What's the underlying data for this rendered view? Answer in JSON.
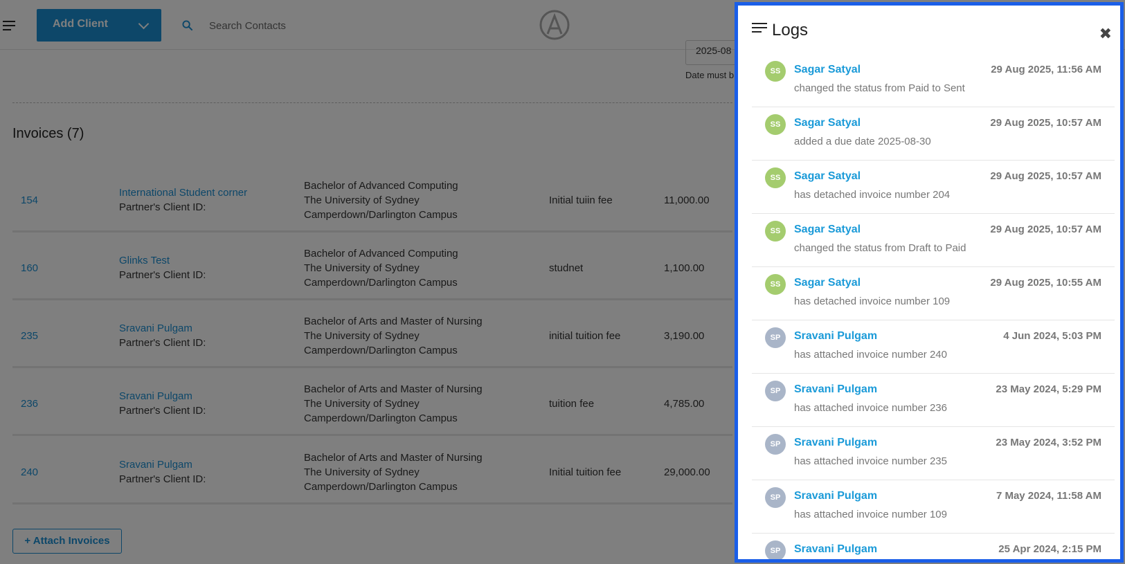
{
  "header": {
    "add_client_label": "Add Client",
    "search_placeholder": "Search Contacts"
  },
  "date_field": {
    "value": "2025-08",
    "hint": "Date must b"
  },
  "invoices": {
    "title": "Invoices (7)",
    "rows": [
      {
        "number": "154",
        "client": "International Student corner",
        "partner": "Partner's Client ID:",
        "course": "Bachelor of Advanced Computing",
        "university": "The University of Sydney",
        "campus": "Camperdown/Darlington Campus",
        "description": "Initial tuiin fee",
        "amount": "11,000.00"
      },
      {
        "number": "160",
        "client": "Glinks Test",
        "partner": "Partner's Client ID:",
        "course": "Bachelor of Advanced Computing",
        "university": "The University of Sydney",
        "campus": "Camperdown/Darlington Campus",
        "description": "studnet",
        "amount": "1,100.00"
      },
      {
        "number": "235",
        "client": "Sravani Pulgam",
        "partner": "Partner's Client ID:",
        "course": "Bachelor of Arts and Master of Nursing",
        "university": "The University of Sydney",
        "campus": "Camperdown/Darlington Campus",
        "description": "initial tuition fee",
        "amount": "3,190.00"
      },
      {
        "number": "236",
        "client": "Sravani Pulgam",
        "partner": "Partner's Client ID:",
        "course": "Bachelor of Arts and Master of Nursing",
        "university": "The University of Sydney",
        "campus": "Camperdown/Darlington Campus",
        "description": "tuition fee",
        "amount": "4,785.00"
      },
      {
        "number": "240",
        "client": "Sravani Pulgam",
        "partner": "Partner's Client ID:",
        "course": "Bachelor of Arts and Master of Nursing",
        "university": "The University of Sydney",
        "campus": "Camperdown/Darlington Campus",
        "description": "Initial tuition fee",
        "amount": "29,000.00"
      }
    ],
    "attach_label": "+ Attach Invoices"
  },
  "logs": {
    "title": "Logs",
    "close_glyph": "✖",
    "items": [
      {
        "initials": "SS",
        "user": "Sagar Satyal",
        "time": "29 Aug 2025, 11:56 AM",
        "action": "changed the status from Paid to Sent"
      },
      {
        "initials": "SS",
        "user": "Sagar Satyal",
        "time": "29 Aug 2025, 10:57 AM",
        "action": "added a due date 2025-08-30"
      },
      {
        "initials": "SS",
        "user": "Sagar Satyal",
        "time": "29 Aug 2025, 10:57 AM",
        "action": "has detached invoice number 204"
      },
      {
        "initials": "SS",
        "user": "Sagar Satyal",
        "time": "29 Aug 2025, 10:57 AM",
        "action": "changed the status from Draft to Paid"
      },
      {
        "initials": "SS",
        "user": "Sagar Satyal",
        "time": "29 Aug 2025, 10:55 AM",
        "action": "has detached invoice number 109"
      },
      {
        "initials": "SP",
        "user": "Sravani Pulgam",
        "time": "4 Jun 2024, 5:03 PM",
        "action": "has attached invoice number 240"
      },
      {
        "initials": "SP",
        "user": "Sravani Pulgam",
        "time": "23 May 2024, 5:29 PM",
        "action": "has attached invoice number 236"
      },
      {
        "initials": "SP",
        "user": "Sravani Pulgam",
        "time": "23 May 2024, 3:52 PM",
        "action": "has attached invoice number 235"
      },
      {
        "initials": "SP",
        "user": "Sravani Pulgam",
        "time": "7 May 2024, 11:58 AM",
        "action": "has attached invoice number 109"
      },
      {
        "initials": "SP",
        "user": "Sravani Pulgam",
        "time": "25 Apr 2024, 2:15 PM",
        "action": ""
      }
    ]
  },
  "colors": {
    "accent": "#1a8ed3",
    "avatar_ss": "#a4cc6e",
    "avatar_sp": "#a9b5c8",
    "panel_border": "#1a5ee8"
  }
}
